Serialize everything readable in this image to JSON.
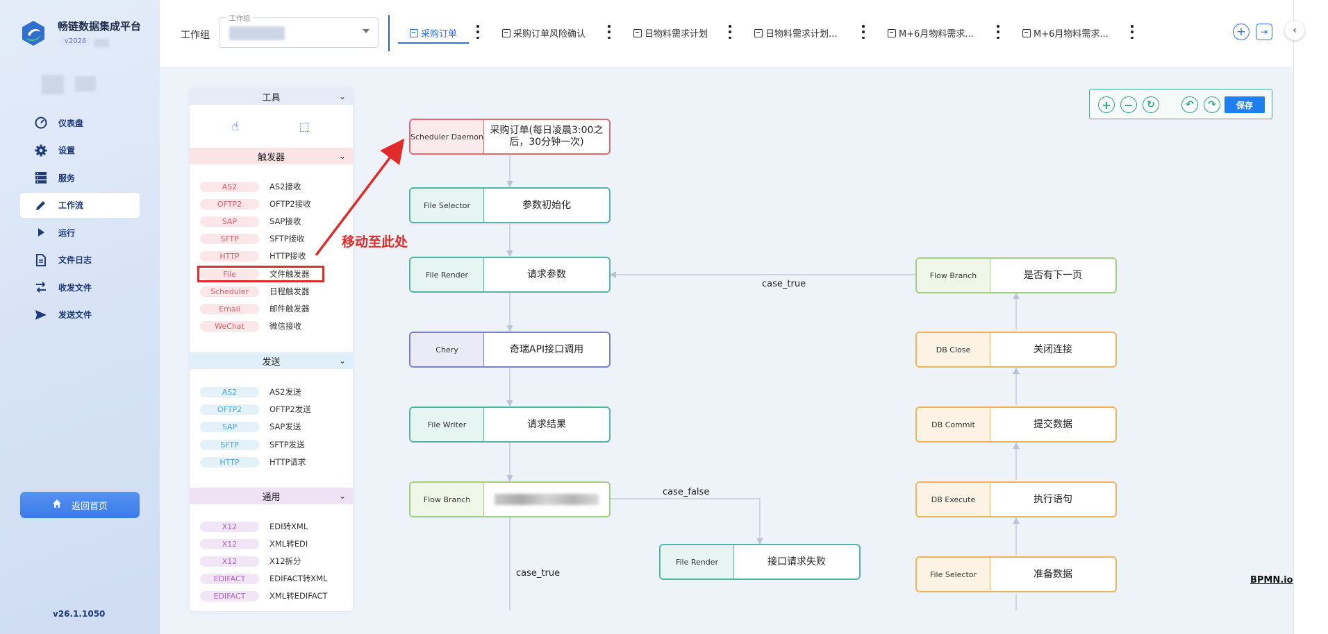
{
  "app": {
    "title": "畅链数据集成平台",
    "version_badge": "v2026",
    "footer_version": "v26.1.1050"
  },
  "sidebar": {
    "items": [
      {
        "label": "仪表盘",
        "icon": "dashboard-icon"
      },
      {
        "label": "设置",
        "icon": "gear-icon"
      },
      {
        "label": "服务",
        "icon": "server-icon"
      },
      {
        "label": "工作流",
        "icon": "pencil-icon",
        "active": true
      },
      {
        "label": "运行",
        "icon": "play-icon"
      },
      {
        "label": "文件日志",
        "icon": "document-icon"
      },
      {
        "label": "收发文件",
        "icon": "transfer-icon"
      },
      {
        "label": "发送文件",
        "icon": "send-icon"
      }
    ],
    "home_button": "返回首页"
  },
  "topbar": {
    "workgroup_label": "工作组",
    "workgroup_float_label": "工作组",
    "tabs": [
      {
        "label": "采购订单",
        "active": true
      },
      {
        "label": "采购订单风险确认"
      },
      {
        "label": "日物料需求计划"
      },
      {
        "label": "日物料需求计划..."
      },
      {
        "label": "M+6月物料需求..."
      },
      {
        "label": "M+6月物料需求..."
      }
    ]
  },
  "tools": {
    "header": "工具",
    "triggers_header": "触发器",
    "triggers": [
      {
        "tag": "AS2",
        "label": "AS2接收"
      },
      {
        "tag": "OFTP2",
        "label": "OFTP2接收"
      },
      {
        "tag": "SAP",
        "label": "SAP接收"
      },
      {
        "tag": "SFTP",
        "label": "SFTP接收"
      },
      {
        "tag": "HTTP",
        "label": "HTTP接收"
      },
      {
        "tag": "File",
        "label": "文件触发器"
      },
      {
        "tag": "Scheduler",
        "label": "日程触发器"
      },
      {
        "tag": "Email",
        "label": "邮件触发器"
      },
      {
        "tag": "WeChat",
        "label": "微信接收"
      }
    ],
    "send_header": "发送",
    "send": [
      {
        "tag": "AS2",
        "label": "AS2发送"
      },
      {
        "tag": "OFTP2",
        "label": "OFTP2发送"
      },
      {
        "tag": "SAP",
        "label": "SAP发送"
      },
      {
        "tag": "SFTP",
        "label": "SFTP发送"
      },
      {
        "tag": "HTTP",
        "label": "HTTP请求"
      }
    ],
    "general_header": "通用",
    "general": [
      {
        "tag": "X12",
        "label": "EDI转XML"
      },
      {
        "tag": "X12",
        "label": "XML转EDI"
      },
      {
        "tag": "X12",
        "label": "X12拆分"
      },
      {
        "tag": "EDIFACT",
        "label": "EDIFACT转XML"
      },
      {
        "tag": "EDIFACT",
        "label": "XML转EDIFACT"
      }
    ]
  },
  "annotation": {
    "text": "移动至此处",
    "color": "#e12a2a"
  },
  "canvas": {
    "save_label": "保存",
    "toolbar_icons": [
      "zoom-in-icon",
      "zoom-out-icon",
      "reset-icon",
      "undo-icon",
      "redo-icon"
    ],
    "nodes": [
      {
        "id": "n1",
        "type": "Scheduler Daemon",
        "label": "采购订单(每日凌晨3:00之后，30分钟一次)",
        "color": "red"
      },
      {
        "id": "n2",
        "type": "File Selector",
        "label": "参数初始化",
        "color": "teal"
      },
      {
        "id": "n3",
        "type": "File Render",
        "label": "请求参数",
        "color": "teal"
      },
      {
        "id": "n4",
        "type": "Chery",
        "label": "奇瑞API接口调用",
        "color": "purple"
      },
      {
        "id": "n5",
        "type": "File Writer",
        "label": "请求结果",
        "color": "teal"
      },
      {
        "id": "n6",
        "type": "Flow Branch",
        "label": "",
        "color": "green"
      },
      {
        "id": "n7",
        "type": "File Render",
        "label": "接口请求失败",
        "color": "teal"
      },
      {
        "id": "n8",
        "type": "Flow Branch",
        "label": "是否有下一页",
        "color": "green"
      },
      {
        "id": "n9",
        "type": "DB Close",
        "label": "关闭连接",
        "color": "orange"
      },
      {
        "id": "n10",
        "type": "DB Commit",
        "label": "提交数据",
        "color": "orange"
      },
      {
        "id": "n11",
        "type": "DB Execute",
        "label": "执行语句",
        "color": "orange"
      },
      {
        "id": "n12",
        "type": "File Selector",
        "label": "准备数据",
        "color": "orange"
      }
    ],
    "edge_labels": {
      "case_true_top": "case_true",
      "case_false": "case_false",
      "case_true_bottom": "case_true"
    },
    "watermark": "BPMN.io"
  },
  "colors": {
    "accent": "#2f6ee0",
    "save": "#1f7ff0",
    "toolbar_green": "#2fa77f",
    "highlight": "#e12a2a"
  }
}
